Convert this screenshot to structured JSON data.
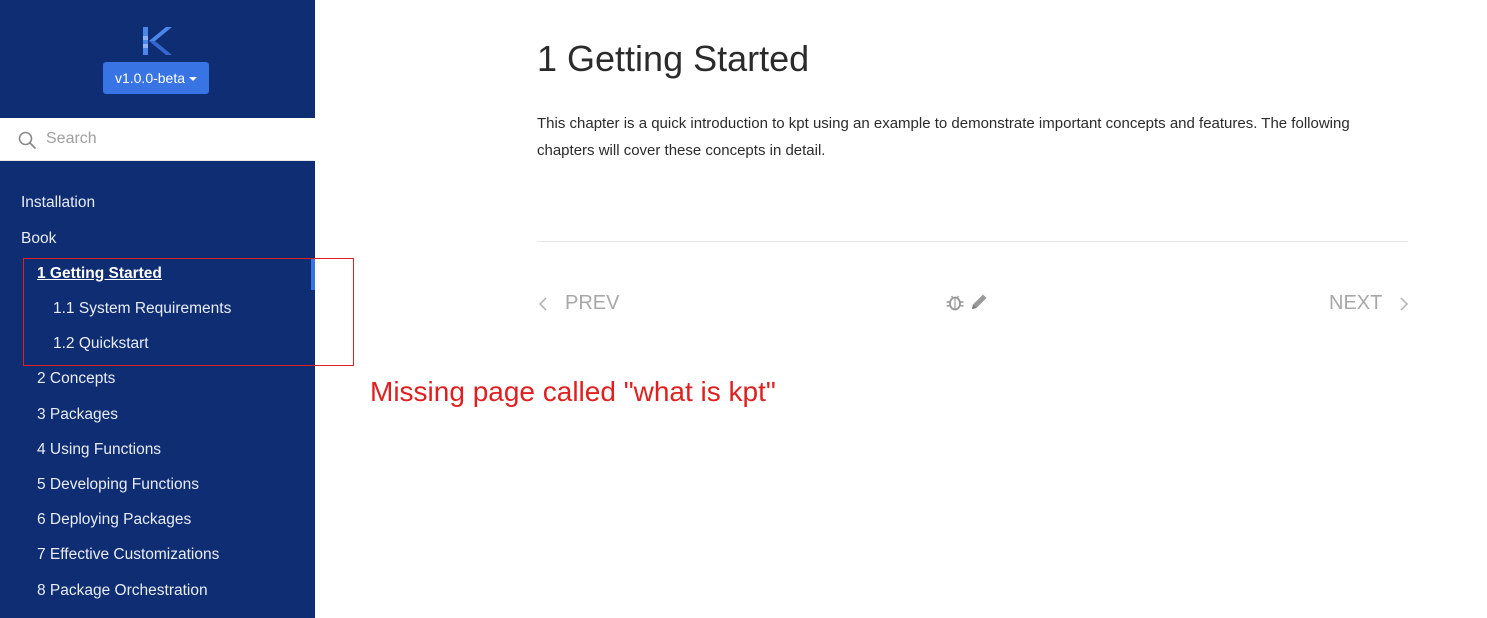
{
  "sidebar": {
    "logo_letter": "K",
    "version_label": "v1.0.0-beta",
    "search_placeholder": "Search",
    "items": [
      {
        "label": "Installation"
      },
      {
        "label": "Book"
      },
      {
        "label": "1 Getting Started"
      },
      {
        "label": "1.1 System Requirements"
      },
      {
        "label": "1.2 Quickstart"
      },
      {
        "label": "2 Concepts"
      },
      {
        "label": "3 Packages"
      },
      {
        "label": "4 Using Functions"
      },
      {
        "label": "5 Developing Functions"
      },
      {
        "label": "6 Deploying Packages"
      },
      {
        "label": "7 Effective Customizations"
      },
      {
        "label": "8 Package Orchestration"
      }
    ]
  },
  "main": {
    "title": "1 Getting Started",
    "intro": "This chapter is a quick introduction to kpt using an example to demonstrate important concepts and features. The following chapters will cover these concepts in detail.",
    "prev_label": "PREV",
    "next_label": "NEXT"
  },
  "annotation": {
    "note": "Missing page called \"what is kpt\""
  },
  "colors": {
    "sidebar_bg": "#0f2d72",
    "accent": "#3874e4",
    "annotation": "#e02020"
  },
  "icons": [
    "kpt-logo-icon",
    "caret-down-icon",
    "search-icon",
    "chevron-left-icon",
    "bug-icon",
    "pencil-icon",
    "chevron-right-icon"
  ]
}
